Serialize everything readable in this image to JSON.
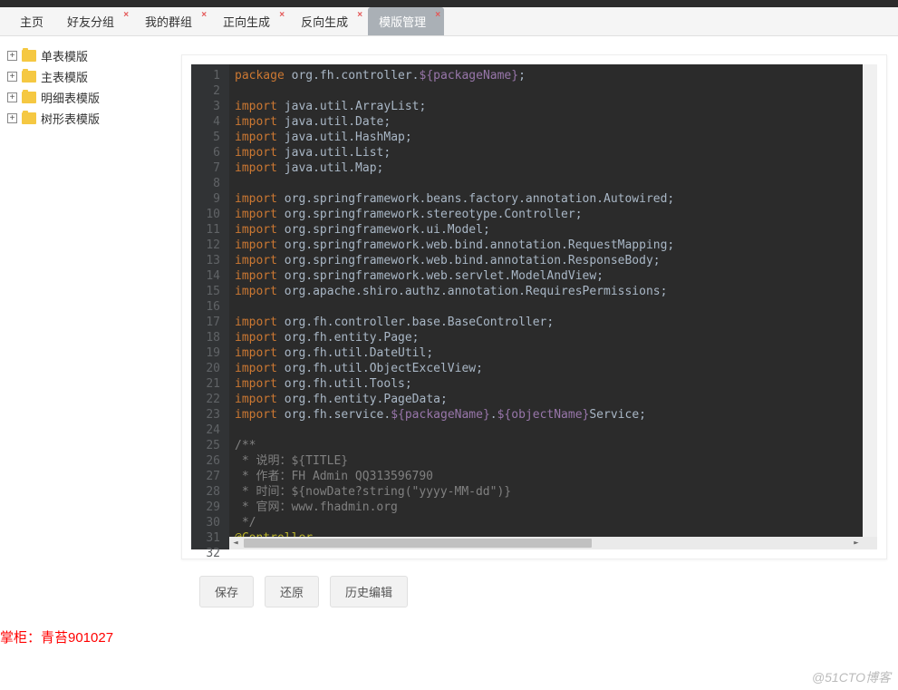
{
  "tabs": [
    {
      "label": "主页",
      "closable": false,
      "active": false
    },
    {
      "label": "好友分组",
      "closable": true,
      "active": false
    },
    {
      "label": "我的群组",
      "closable": true,
      "active": false
    },
    {
      "label": "正向生成",
      "closable": true,
      "active": false
    },
    {
      "label": "反向生成",
      "closable": true,
      "active": false
    },
    {
      "label": "模版管理",
      "closable": true,
      "active": true
    }
  ],
  "tree": [
    {
      "label": "单表模版"
    },
    {
      "label": "主表模版"
    },
    {
      "label": "明细表模版"
    },
    {
      "label": "树形表模版"
    }
  ],
  "buttons": {
    "save": "保存",
    "restore": "还原",
    "history": "历史编辑"
  },
  "owner_label": "掌柜：青苔901027",
  "watermark": "@51CTO博客",
  "code_lines": [
    {
      "n": 1,
      "tokens": [
        [
          "kw",
          "package"
        ],
        [
          "pkg",
          " org.fh.controller."
        ],
        [
          "var",
          "${packageName}"
        ],
        [
          "pkg",
          ";"
        ]
      ]
    },
    {
      "n": 2,
      "tokens": []
    },
    {
      "n": 3,
      "tokens": [
        [
          "kw",
          "import"
        ],
        [
          "pkg",
          " java.util.ArrayList;"
        ]
      ]
    },
    {
      "n": 4,
      "tokens": [
        [
          "kw",
          "import"
        ],
        [
          "pkg",
          " java.util.Date;"
        ]
      ]
    },
    {
      "n": 5,
      "tokens": [
        [
          "kw",
          "import"
        ],
        [
          "pkg",
          " java.util.HashMap;"
        ]
      ]
    },
    {
      "n": 6,
      "tokens": [
        [
          "kw",
          "import"
        ],
        [
          "pkg",
          " java.util.List;"
        ]
      ]
    },
    {
      "n": 7,
      "tokens": [
        [
          "kw",
          "import"
        ],
        [
          "pkg",
          " java.util.Map;"
        ]
      ]
    },
    {
      "n": 8,
      "tokens": []
    },
    {
      "n": 9,
      "tokens": [
        [
          "kw",
          "import"
        ],
        [
          "pkg",
          " org.springframework.beans.factory.annotation.Autowired;"
        ]
      ]
    },
    {
      "n": 10,
      "tokens": [
        [
          "kw",
          "import"
        ],
        [
          "pkg",
          " org.springframework.stereotype.Controller;"
        ]
      ]
    },
    {
      "n": 11,
      "tokens": [
        [
          "kw",
          "import"
        ],
        [
          "pkg",
          " org.springframework.ui.Model;"
        ]
      ]
    },
    {
      "n": 12,
      "tokens": [
        [
          "kw",
          "import"
        ],
        [
          "pkg",
          " org.springframework.web.bind.annotation.RequestMapping;"
        ]
      ]
    },
    {
      "n": 13,
      "tokens": [
        [
          "kw",
          "import"
        ],
        [
          "pkg",
          " org.springframework.web.bind.annotation.ResponseBody;"
        ]
      ]
    },
    {
      "n": 14,
      "tokens": [
        [
          "kw",
          "import"
        ],
        [
          "pkg",
          " org.springframework.web.servlet.ModelAndView;"
        ]
      ]
    },
    {
      "n": 15,
      "tokens": [
        [
          "kw",
          "import"
        ],
        [
          "pkg",
          " org.apache.shiro.authz.annotation.RequiresPermissions;"
        ]
      ]
    },
    {
      "n": 16,
      "tokens": []
    },
    {
      "n": 17,
      "tokens": [
        [
          "kw",
          "import"
        ],
        [
          "pkg",
          " org.fh.controller.base.BaseController;"
        ]
      ]
    },
    {
      "n": 18,
      "tokens": [
        [
          "kw",
          "import"
        ],
        [
          "pkg",
          " org.fh.entity.Page;"
        ]
      ]
    },
    {
      "n": 19,
      "tokens": [
        [
          "kw",
          "import"
        ],
        [
          "pkg",
          " org.fh.util.DateUtil;"
        ]
      ]
    },
    {
      "n": 20,
      "tokens": [
        [
          "kw",
          "import"
        ],
        [
          "pkg",
          " org.fh.util.ObjectExcelView;"
        ]
      ]
    },
    {
      "n": 21,
      "tokens": [
        [
          "kw",
          "import"
        ],
        [
          "pkg",
          " org.fh.util.Tools;"
        ]
      ]
    },
    {
      "n": 22,
      "tokens": [
        [
          "kw",
          "import"
        ],
        [
          "pkg",
          " org.fh.entity.PageData;"
        ]
      ]
    },
    {
      "n": 23,
      "tokens": [
        [
          "kw",
          "import"
        ],
        [
          "pkg",
          " org.fh.service."
        ],
        [
          "var",
          "${packageName}"
        ],
        [
          "pkg",
          "."
        ],
        [
          "var",
          "${objectName}"
        ],
        [
          "pkg",
          "Service;"
        ]
      ]
    },
    {
      "n": 24,
      "tokens": []
    },
    {
      "n": 25,
      "tokens": [
        [
          "cmt",
          "/**"
        ]
      ],
      "fold": true
    },
    {
      "n": 26,
      "tokens": [
        [
          "cmt",
          " * 说明：${TITLE}"
        ]
      ]
    },
    {
      "n": 27,
      "tokens": [
        [
          "cmt",
          " * 作者：FH Admin QQ313596790"
        ]
      ]
    },
    {
      "n": 28,
      "tokens": [
        [
          "cmt",
          " * 时间：${nowDate?string(\"yyyy-MM-dd\")}"
        ]
      ]
    },
    {
      "n": 29,
      "tokens": [
        [
          "cmt",
          " * 官网：www.fhadmin.org"
        ]
      ]
    },
    {
      "n": 30,
      "tokens": [
        [
          "cmt",
          " */"
        ]
      ]
    },
    {
      "n": 31,
      "tokens": [
        [
          "ann",
          "@Controller"
        ]
      ]
    },
    {
      "n": 32,
      "tokens": []
    }
  ]
}
